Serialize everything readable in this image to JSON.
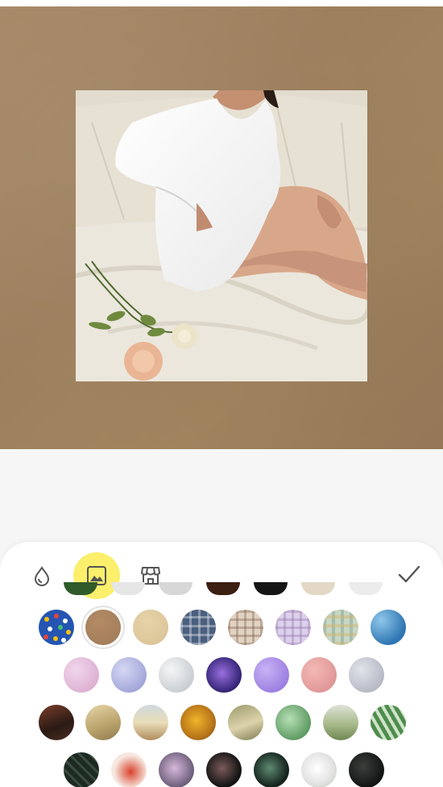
{
  "toolbar": {
    "tools": [
      {
        "name": "color",
        "icon": "drop-icon",
        "active": false
      },
      {
        "name": "background-image",
        "icon": "image-icon",
        "active": true
      },
      {
        "name": "shop",
        "icon": "store-icon",
        "active": false
      }
    ],
    "confirm_icon": "checkmark-icon",
    "active_color": "#fbef6b"
  },
  "canvas": {
    "background": "kraft-paper",
    "background_color": "#a0825f"
  },
  "swatch_rows": [
    [
      "polka-dots-blue",
      "kraft-paper",
      "beige-linen",
      "navy-plaid",
      "tan-plaid",
      "lilac-plaid",
      "sage-plaid",
      "blue-water"
    ],
    [
      "pink-marble",
      "periwinkle-marble",
      "silver-marble",
      "violet-galaxy",
      "purple-marble",
      "rose-marble",
      "grey-marble"
    ],
    [
      "painting-dark-room",
      "painting-classic",
      "painting-seaside",
      "painting-sunflowers",
      "painting-shells",
      "green-foliage",
      "painting-landscape",
      "palm-leaves"
    ],
    [
      "dark-leaves",
      "red-floral",
      "lilac-blossom",
      "dark-flowers",
      "dark-monstera",
      "white-flowers",
      "black-marble"
    ]
  ],
  "selected_swatch": "kraft-paper"
}
